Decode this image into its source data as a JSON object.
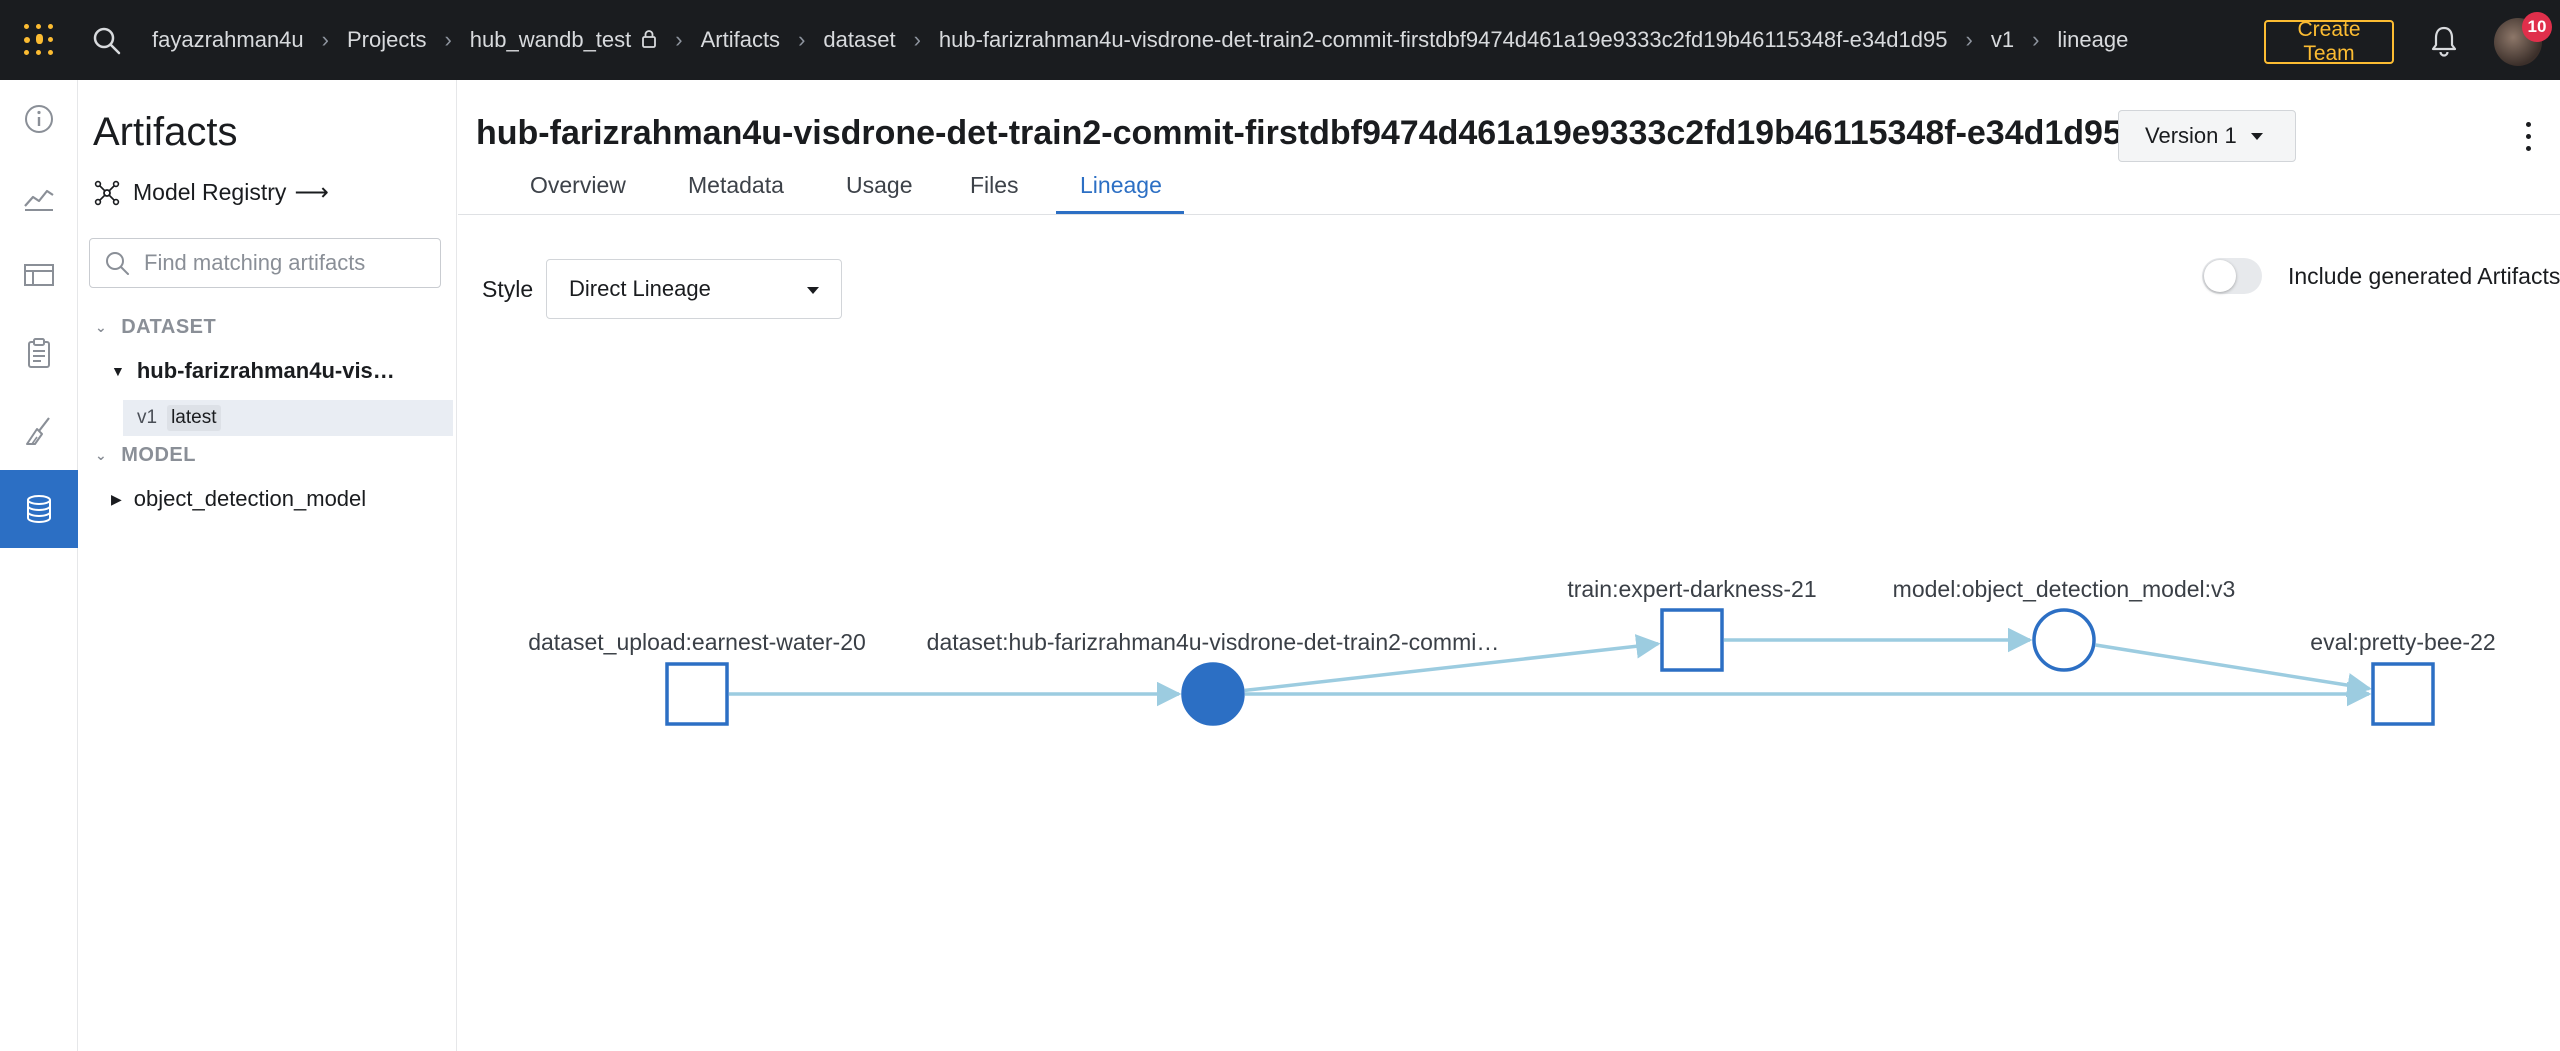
{
  "topbar": {
    "breadcrumbs": [
      "fayazrahman4u",
      "Projects",
      "hub_wandb_test",
      "Artifacts",
      "dataset",
      "hub-farizrahman4u-visdrone-det-train2-commit-firstdbf9474d461a19e9333c2fd19b46115348f-e34d1d95",
      "v1",
      "lineage"
    ],
    "create_team_label": "Create Team",
    "notification_count": "10",
    "accent_color": "#fcbc32"
  },
  "rail": {
    "icons": [
      "info-icon",
      "line-chart-icon",
      "table-icon",
      "clipboard-icon",
      "sweep-broom-icon",
      "database-icon"
    ],
    "active": "database-icon"
  },
  "sidebar": {
    "title": "Artifacts",
    "model_registry_label": "Model Registry",
    "model_registry_arrow": "⟶",
    "search_placeholder": "Find matching artifacts",
    "groups": [
      {
        "name": "DATASET",
        "items": [
          {
            "label": "hub-farizrahman4u-vis…",
            "versions": [
              {
                "version": "v1",
                "tag": "latest"
              }
            ]
          }
        ]
      },
      {
        "name": "MODEL",
        "items": [
          {
            "label": "object_detection_model"
          }
        ]
      }
    ]
  },
  "main": {
    "title": "hub-farizrahman4u-visdrone-det-train2-commit-firstdbf9474d461a19e9333c2fd19b46115348f-e34d1d95",
    "version_select": "Version 1",
    "tabs": [
      "Overview",
      "Metadata",
      "Usage",
      "Files",
      "Lineage"
    ],
    "active_tab": "Lineage",
    "style_label": "Style",
    "style_value": "Direct Lineage",
    "include_generated_label": "Include generated Artifacts",
    "include_generated_on": false
  },
  "lineage": {
    "edge_color": "#9ccce0",
    "node_color": "#2c6fc4",
    "nodes": [
      {
        "id": "run1",
        "kind": "run",
        "label": "dataset_upload:earnest-water-20"
      },
      {
        "id": "art1",
        "kind": "artifact-current",
        "label": "dataset:hub-farizrahman4u-visdrone-det-train2-commi…"
      },
      {
        "id": "run2",
        "kind": "run",
        "label": "train:expert-darkness-21"
      },
      {
        "id": "art2",
        "kind": "artifact",
        "label": "model:object_detection_model:v3"
      },
      {
        "id": "run3",
        "kind": "run",
        "label": "eval:pretty-bee-22"
      }
    ],
    "edges": [
      {
        "from": "run1",
        "to": "art1"
      },
      {
        "from": "art1",
        "to": "run2"
      },
      {
        "from": "run2",
        "to": "art2"
      },
      {
        "from": "art2",
        "to": "run3"
      },
      {
        "from": "art1",
        "to": "run3"
      }
    ]
  }
}
